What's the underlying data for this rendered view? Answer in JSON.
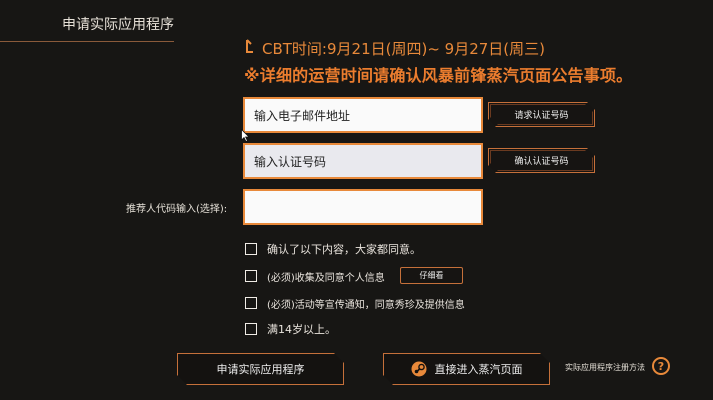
{
  "header": {
    "title": "申请实际应用程序"
  },
  "notice": {
    "cbt_line": "CBT时间:9月21日(周四)~ 9月27日(周三)",
    "detail_line": "※详细的运营时间请确认风暴前锋蒸汽页面公告事项。",
    "accent_color": "#e8893a"
  },
  "form": {
    "email_placeholder": "输入电子邮件地址",
    "code_placeholder": "输入认证号码",
    "referral_label": "推荐人代码输入(选择):",
    "referral_value": "",
    "request_code_label": "请求认证号码",
    "confirm_code_label": "确认认证号码"
  },
  "checkboxes": [
    {
      "label": "确认了以下内容，大家都同意。",
      "checked": false
    },
    {
      "label": "(必须)收集及同意个人信息",
      "checked": false,
      "detail_label": "仔细看"
    },
    {
      "label": "(必须)活动等宣传通知，同意秀珍及提供信息",
      "checked": false
    },
    {
      "label": "满14岁以上。",
      "checked": false
    }
  ],
  "footer": {
    "apply_label": "申请实际应用程序",
    "steam_label": "直接进入蒸汽页面",
    "help_link_label": "实际应用程序注册方法",
    "help_icon_glyph": "?",
    "icons": [
      "steam-icon",
      "help-icon"
    ]
  }
}
